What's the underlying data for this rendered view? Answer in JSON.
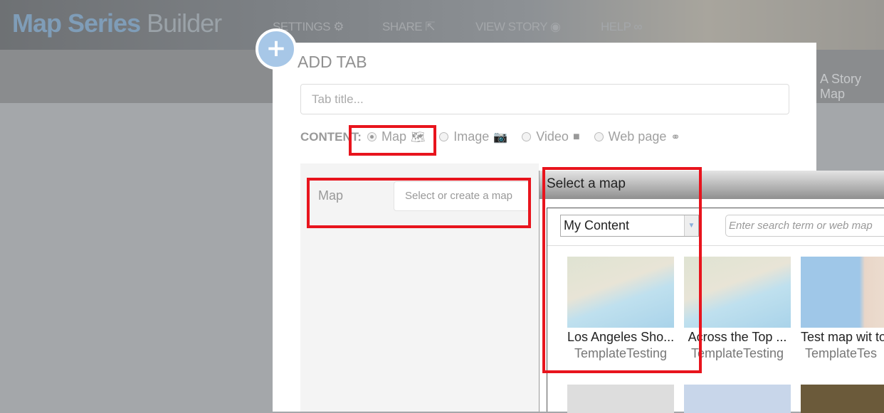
{
  "header": {
    "brand_bold": "Map Series",
    "brand_light": "Builder",
    "nav": [
      {
        "label": "SETTINGS",
        "icon": "gears-icon"
      },
      {
        "label": "SHARE",
        "icon": "share-icon"
      },
      {
        "label": "VIEW STORY",
        "icon": "eye-icon"
      },
      {
        "label": "HELP",
        "icon": "binoculars-icon"
      }
    ],
    "story_label": "A Story Map"
  },
  "modal": {
    "title": "ADD TAB",
    "tab_title_placeholder": "Tab title...",
    "content_label": "CONTENT:",
    "options": [
      {
        "label": "Map",
        "selected": true,
        "icon": "map-icon"
      },
      {
        "label": "Image",
        "selected": false,
        "icon": "camera-icon"
      },
      {
        "label": "Video",
        "selected": false,
        "icon": "video-icon"
      },
      {
        "label": "Web page",
        "selected": false,
        "icon": "link-icon"
      }
    ],
    "map_label": "Map",
    "select_button": "Select or create a map"
  },
  "dialog": {
    "title": "Select a map",
    "source": "My Content",
    "search_placeholder": "Enter search term or web map",
    "items": [
      {
        "title": "Los Angeles Sho...",
        "owner": "TemplateTesting"
      },
      {
        "title": "Across the Top ...",
        "owner": "TemplateTesting"
      },
      {
        "title": "Test map wit to",
        "owner": "TemplateTes"
      }
    ]
  },
  "colors": {
    "highlight": "#e8141d",
    "accent": "#a7c7e7"
  }
}
